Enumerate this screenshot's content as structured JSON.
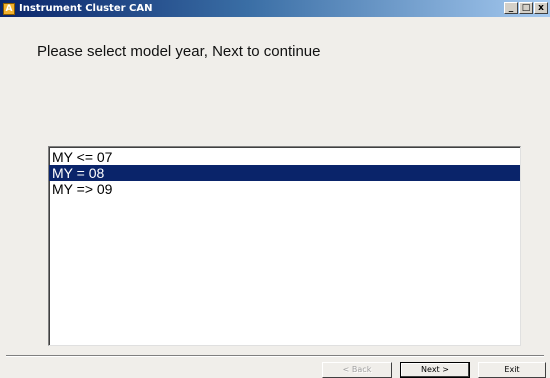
{
  "window": {
    "title": "Instrument Cluster CAN",
    "icon_letter": "A",
    "controls": {
      "minimize": "_",
      "maximize": "□",
      "close": "x"
    }
  },
  "main": {
    "prompt": "Please select model year, Next to continue",
    "model_years": [
      {
        "label": "MY <= 07",
        "selected": false
      },
      {
        "label": "MY = 08",
        "selected": true
      },
      {
        "label": "MY => 09",
        "selected": false
      }
    ]
  },
  "buttons": {
    "back": "< Back",
    "next": "Next >",
    "exit": "Exit"
  },
  "colors": {
    "selection": "#0a246a",
    "title_gradient_start": "#0a246a",
    "title_gradient_end": "#a6caf0",
    "dialog_bg": "#f0eeea"
  }
}
